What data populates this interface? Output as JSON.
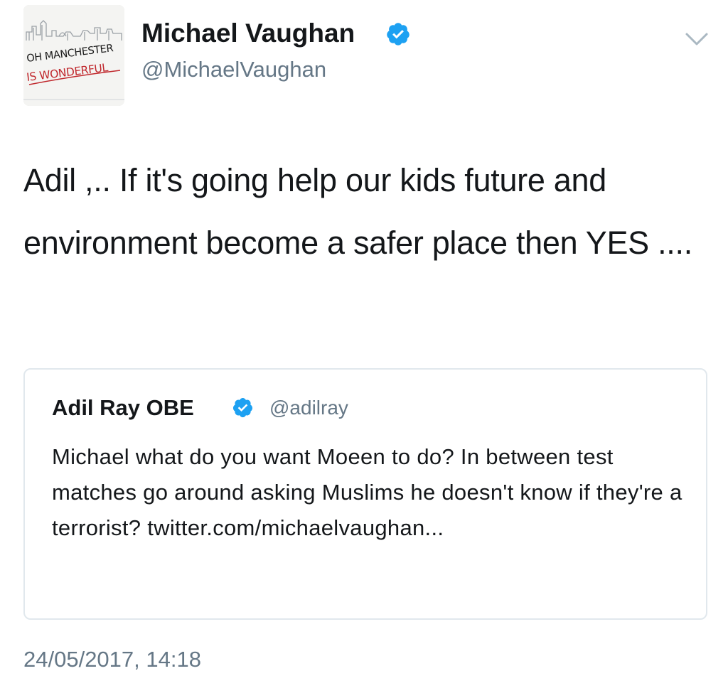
{
  "tweet": {
    "author": {
      "name": "Michael Vaughan",
      "handle": "@MichaelVaughan",
      "verified": true,
      "avatar_text_line1": "OH MANCHESTER",
      "avatar_text_line2": "IS WONDERFUL"
    },
    "menu_icon": "chevron-down-icon",
    "text": "Adil ,.. If it's going help our kids future and environment become a safer place then YES ....",
    "quoted_tweet": {
      "author_name": "Adil Ray OBE",
      "handle": "@adilray",
      "verified": true,
      "text": "Michael what do you want Moeen to do? In between test matches go around asking Muslims he doesn't know if they're a terrorist? twitter.com/michaelvaughan..."
    },
    "timestamp": "24/05/2017, 14:18"
  },
  "colors": {
    "verified_blue": "#1da1f2",
    "text_primary": "#14171a",
    "text_secondary": "#657786",
    "border": "#e1e8ed",
    "avatar_red": "#c0282d"
  }
}
